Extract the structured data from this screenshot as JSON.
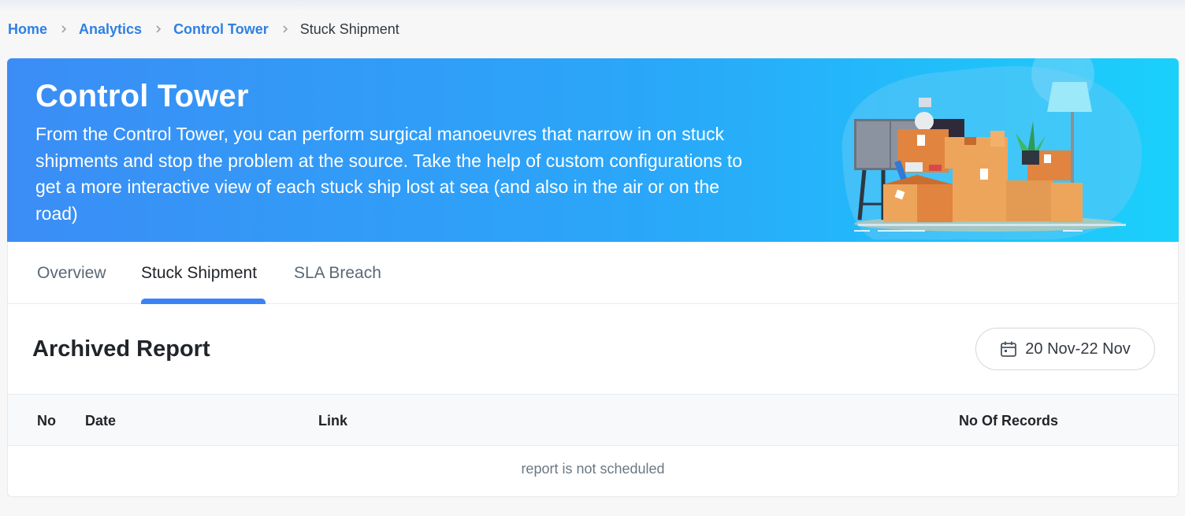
{
  "breadcrumb": {
    "items": [
      "Home",
      "Analytics",
      "Control Tower"
    ],
    "current": "Stuck Shipment"
  },
  "banner": {
    "title": "Control Tower",
    "description": "From the Control Tower, you can perform surgical manoeuvres that narrow in on stuck shipments and stop the problem at the source. Take the help of custom configurations to get a more interactive view of each stuck ship lost at sea (and also in the air or on the road)"
  },
  "tabs": [
    {
      "label": "Overview",
      "active": false
    },
    {
      "label": "Stuck Shipment",
      "active": true
    },
    {
      "label": "SLA Breach",
      "active": false
    }
  ],
  "report": {
    "title": "Archived Report",
    "date_range": "20 Nov-22 Nov",
    "date_icon": "calendar-icon",
    "columns": [
      "No",
      "Date",
      "Link",
      "No Of Records"
    ],
    "empty_message": "report is not scheduled"
  },
  "colors": {
    "accent": "#3b82f6",
    "link": "#2f80e4",
    "banner_start": "#3b8df5",
    "banner_end": "#1bd0fb"
  }
}
